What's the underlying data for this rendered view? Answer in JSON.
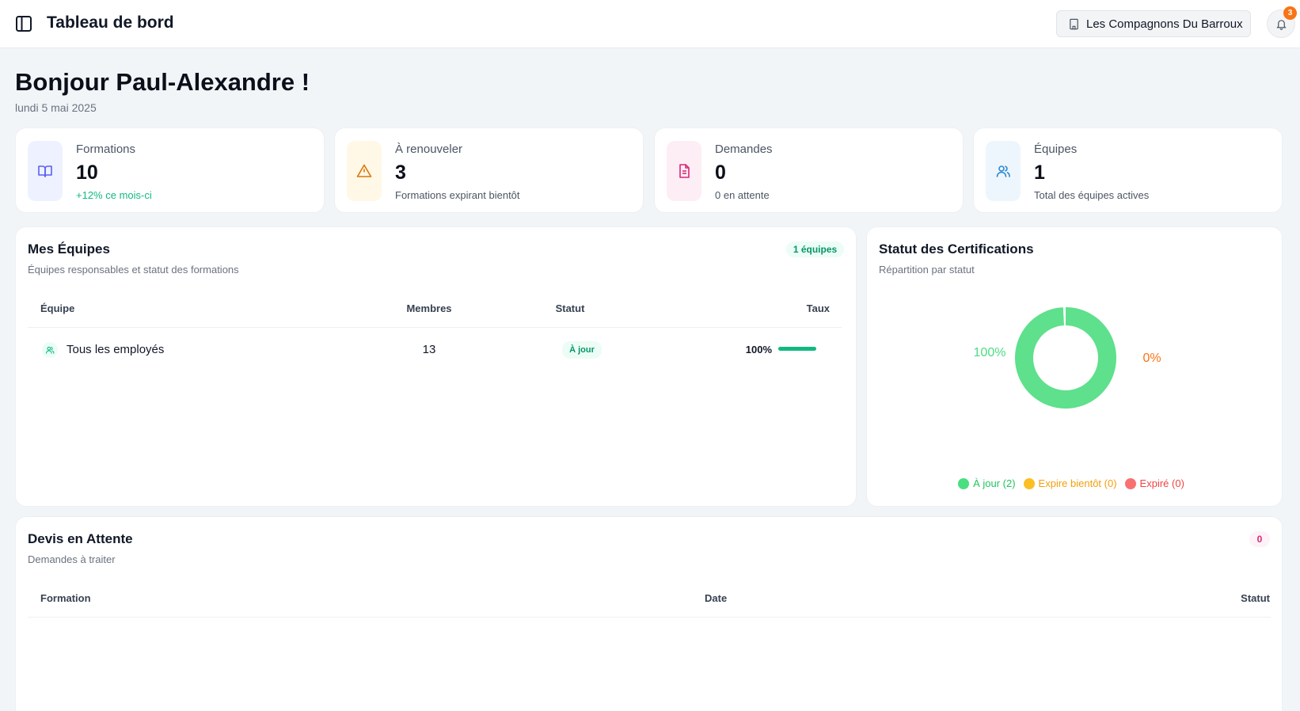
{
  "header": {
    "title": "Tableau de bord",
    "organization": "Les Compagnons Du Barroux",
    "notification_count": "3"
  },
  "greeting": "Bonjour Paul-Alexandre !",
  "date": "lundi 5 mai 2025",
  "stats": [
    {
      "label": "Formations",
      "value": "10",
      "sub": "+12% ce mois-ci",
      "icon": "book-icon"
    },
    {
      "label": "À renouveler",
      "value": "3",
      "sub": "Formations expirant bientôt",
      "icon": "warning-icon"
    },
    {
      "label": "Demandes",
      "value": "0",
      "sub": "0 en attente",
      "icon": "document-icon"
    },
    {
      "label": "Équipes",
      "value": "1",
      "sub": "Total des équipes actives",
      "icon": "users-icon"
    }
  ],
  "teams": {
    "title": "Mes Équipes",
    "subtitle": "Équipes responsables et statut des formations",
    "badge": "1 équipes",
    "columns": [
      "Équipe",
      "Membres",
      "Statut",
      "Taux"
    ],
    "rows": [
      {
        "name": "Tous les employés",
        "members": "13",
        "status": "À jour",
        "rate": "100%",
        "rate_value": 1.0
      }
    ]
  },
  "certifications": {
    "title": "Statut des Certifications",
    "subtitle": "Répartition par statut",
    "chart_data": {
      "type": "pie",
      "labels": [
        "À jour",
        "Expire bientôt",
        "Expiré"
      ],
      "values": [
        2,
        0,
        0
      ],
      "slice_labels": [
        "100%",
        "0%"
      ],
      "colors": [
        "#5ee08c",
        "#fbbf24",
        "#f87171"
      ]
    },
    "legend": [
      {
        "label": "À jour (2)",
        "color": "#4ade80",
        "text_color": "#22c55e"
      },
      {
        "label": "Expire bientôt (0)",
        "color": "#fbbf24",
        "text_color": "#f59e0b"
      },
      {
        "label": "Expiré (0)",
        "color": "#f87171",
        "text_color": "#ef4444"
      }
    ]
  },
  "quotes": {
    "title": "Devis en Attente",
    "subtitle": "Demandes à traiter",
    "badge": "0",
    "columns": [
      "Formation",
      "Date",
      "Statut"
    ]
  },
  "colors": {
    "accent_green": "#10b981",
    "accent_orange": "#f97316",
    "accent_pink": "#db2777"
  }
}
